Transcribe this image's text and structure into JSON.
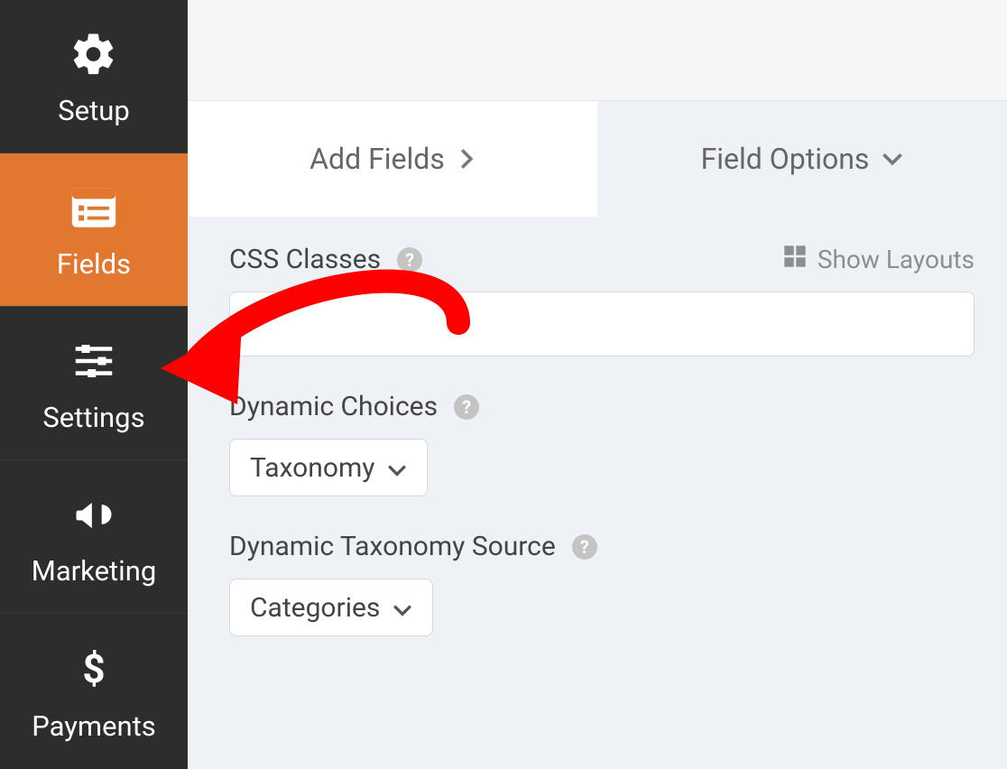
{
  "sidebar": {
    "items": [
      {
        "label": "Setup"
      },
      {
        "label": "Fields"
      },
      {
        "label": "Settings"
      },
      {
        "label": "Marketing"
      },
      {
        "label": "Payments"
      }
    ]
  },
  "tabs": {
    "add_fields": "Add Fields",
    "field_options": "Field Options"
  },
  "panel": {
    "css_classes_label": "CSS Classes",
    "css_classes_value": "",
    "show_layouts": "Show Layouts",
    "dynamic_choices_label": "Dynamic Choices",
    "dynamic_choices_value": "Taxonomy",
    "dynamic_taxonomy_source_label": "Dynamic Taxonomy Source",
    "dynamic_taxonomy_source_value": "Categories"
  }
}
